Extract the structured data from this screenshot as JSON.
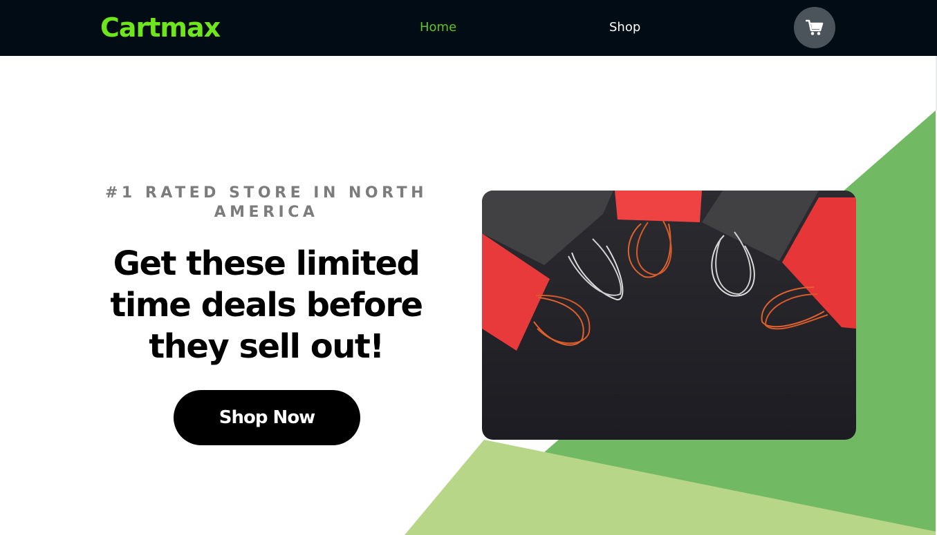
{
  "header": {
    "logo": "Cartmax",
    "nav": {
      "home": "Home",
      "shop": "Shop"
    },
    "cart_icon": "shopping-cart-icon"
  },
  "hero": {
    "eyebrow": "#1 RATED STORE IN NORTH AMERICA",
    "headline": "Get these limited time deals before they sell out!",
    "cta_label": "Shop Now",
    "image": "shopping-bags-photo"
  },
  "colors": {
    "navbar": "#020c15",
    "logo": "#6ee51d",
    "nav_active": "#5ec41e",
    "cart_button": "#4b545b",
    "accent_green": "#72b963",
    "accent_light_green": "#b7d688",
    "cta": "#000000"
  }
}
